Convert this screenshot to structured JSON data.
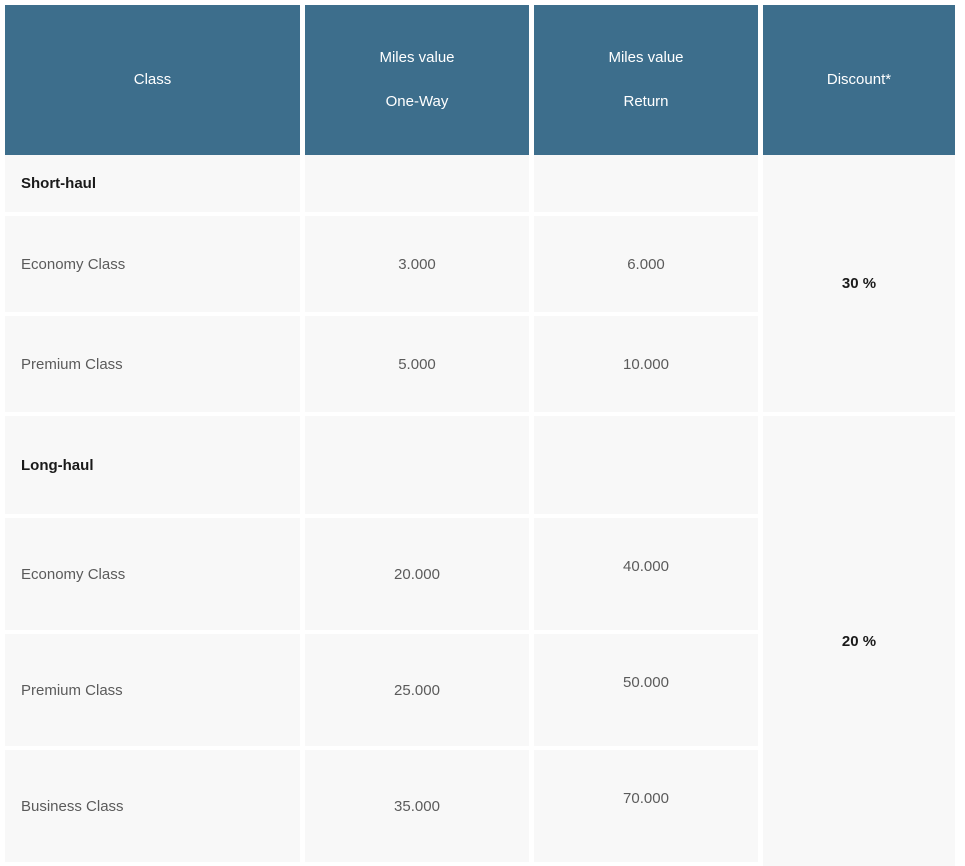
{
  "table": {
    "columns": [
      {
        "id": "class",
        "label_lines": [
          "Class"
        ]
      },
      {
        "id": "miles_one_way",
        "label_lines": [
          "Miles value",
          "One-Way"
        ]
      },
      {
        "id": "miles_return",
        "label_lines": [
          "Miles value",
          "Return"
        ]
      },
      {
        "id": "discount",
        "label_lines": [
          "Discount*"
        ]
      }
    ],
    "header": {
      "class": "Class",
      "one_way_l1": "Miles value",
      "one_way_l2": "One-Way",
      "return_l1": "Miles value",
      "return_l2": "Return",
      "discount": "Discount*"
    },
    "sections": [
      {
        "title": "Short-haul",
        "discount": "30 %",
        "rows": [
          {
            "class": "Economy Class",
            "one_way": "3.000",
            "return": "6.000"
          },
          {
            "class": "Premium Class",
            "one_way": "5.000",
            "return": "10.000"
          }
        ]
      },
      {
        "title": "Long-haul",
        "discount": "20 %",
        "rows": [
          {
            "class": "Economy Class",
            "one_way": "20.000",
            "return": "40.000"
          },
          {
            "class": "Premium Class",
            "one_way": "25.000",
            "return": "50.000"
          },
          {
            "class": "Business Class",
            "one_way": "35.000",
            "return": "70.000"
          }
        ]
      }
    ],
    "colors": {
      "header_bg": "#3d6e8c",
      "header_text": "#ffffff",
      "cell_bg": "#f8f8f8",
      "cell_text": "#5b5b5b",
      "section_text": "#1a1a1a",
      "gap": "#ffffff"
    }
  }
}
